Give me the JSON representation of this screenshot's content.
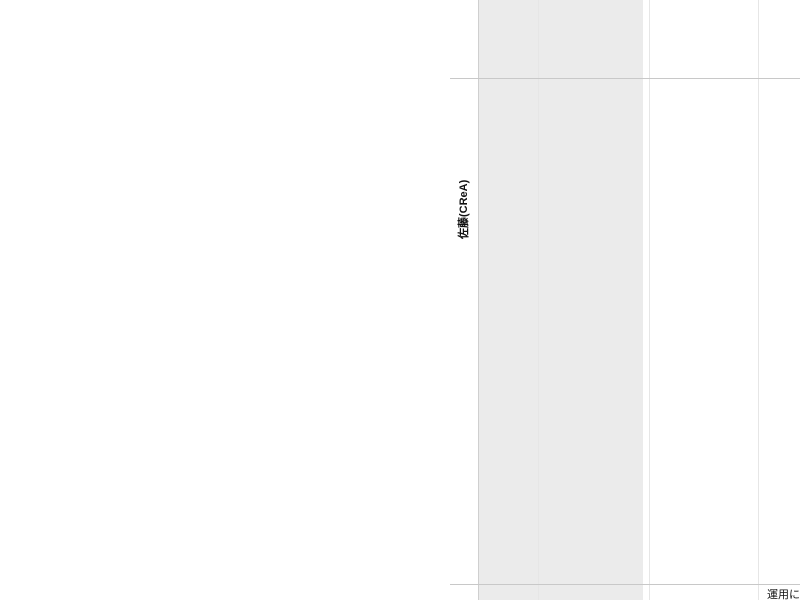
{
  "board": {
    "lane_label": "佐藤(CReA)",
    "bottom_cell_text": "運用に"
  }
}
